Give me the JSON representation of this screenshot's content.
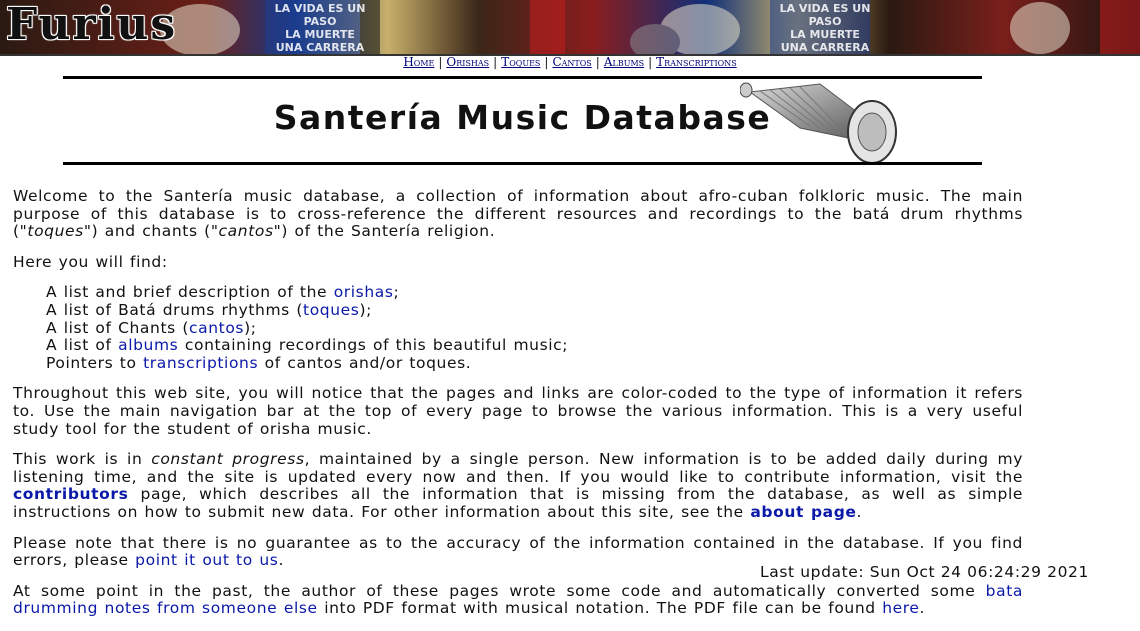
{
  "banner": {
    "logo_text": "Furius",
    "poster_line1": "LA VIDA ES UN PASO",
    "poster_line2": "LA MUERTE",
    "poster_line3": "UNA CARRERA"
  },
  "nav": {
    "items": [
      "Home",
      "Orishas",
      "Toques",
      "Cantos",
      "Albums",
      "Transcriptions"
    ],
    "separator": "|"
  },
  "header": {
    "title": "Santería Music Database"
  },
  "intro": {
    "p1": "Welcome to the Santería music database, a collection of information about afro-cuban folkloric music. The main purpose of this database is to cross-reference the different resources and recordings to the batá drum rhythms (",
    "p1_toques": "\"toques\"",
    "p1_mid": ") and chants (",
    "p1_cantos": "\"cantos\"",
    "p1_end": ") of the Santería religion.",
    "find_heading": "Here you will find:"
  },
  "find_list": [
    {
      "before": "A list and brief description of the ",
      "link": "orishas",
      "after": ";"
    },
    {
      "before": "A list of Batá drums rhythms (",
      "link": "toques",
      "after": ");"
    },
    {
      "before": "A list of Chants (",
      "link": "cantos",
      "after": ");"
    },
    {
      "before": "A list of ",
      "link": "albums",
      "after": " containing recordings of this beautiful music;"
    },
    {
      "before": "Pointers to ",
      "link": "transcriptions",
      "after": " of cantos and/or toques."
    }
  ],
  "paragraphs": {
    "nav_text": "Throughout this web site, you will notice that the pages and links are color-coded to the type of information it refers to. Use the main navigation bar at the top of every page to browse the various information. This is a very useful study tool for the student of orisha music.",
    "work_a": "This work is in ",
    "work_em": "constant progress",
    "work_b": ", maintained by a single person. New information is to be added daily during my listening time, and the site is updated every now and then. If you would like to contribute information, visit the ",
    "work_link1": "contributors",
    "work_c": " page, which describes all the information that is missing from the database, as well as simple instructions on how to submit new data. For other information about this site, see the ",
    "work_link2": "about page",
    "work_d": ".",
    "note_a": "Please note that there is no guarantee as to the accuracy of the information contained in the database. If you find errors, please ",
    "note_link": "point it out to us",
    "note_b": ".",
    "past_a": "At some point in the past, the author of these pages wrote some code and automatically converted some ",
    "past_link1": "bata drumming notes from someone else",
    "past_b": " into PDF format with musical notation. The PDF file can be found ",
    "past_link2": "here",
    "past_c": "."
  },
  "footer": {
    "last_update": "Last update: Sun Oct 24 06:24:29 2021"
  },
  "colors": {
    "link": "#0a19a8",
    "nav_link": "#00007a"
  }
}
